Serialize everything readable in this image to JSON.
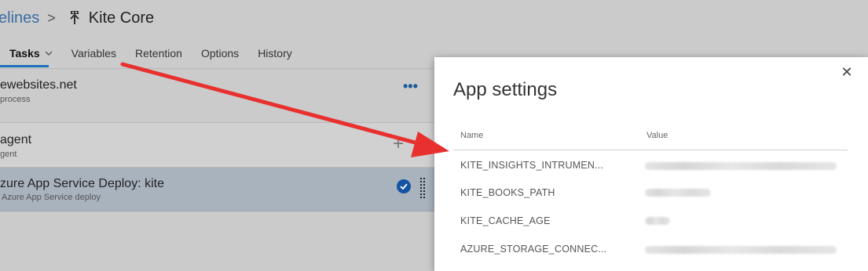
{
  "breadcrumb": {
    "parent": "elines",
    "separator": ">",
    "title": "Kite Core"
  },
  "tabs": [
    {
      "label": "Tasks",
      "active": true
    },
    {
      "label": "Variables"
    },
    {
      "label": "Retention"
    },
    {
      "label": "Options"
    },
    {
      "label": "History"
    }
  ],
  "tasks": {
    "phase": {
      "title": "ewebsites.net",
      "subtitle": "process"
    },
    "agent": {
      "title": "agent",
      "subtitle": "gent"
    },
    "deploy": {
      "title": "zure App Service Deploy: kite",
      "subtitle": "Azure App Service deploy"
    },
    "more_label": "•••",
    "add_label": "+"
  },
  "dialog": {
    "title": "App settings",
    "close_label": "✕",
    "columns": {
      "name": "Name",
      "value": "Value"
    },
    "rows": [
      {
        "name": "KITE_INSIGHTS_INTRUMEN..."
      },
      {
        "name": "KITE_BOOKS_PATH"
      },
      {
        "name": "KITE_CACHE_AGE"
      },
      {
        "name": "AZURE_STORAGE_CONNEC..."
      }
    ]
  },
  "colors": {
    "accent": "#1c6fbf",
    "annotation_arrow": "#e8312f",
    "selected_row": "#a9b3be"
  }
}
